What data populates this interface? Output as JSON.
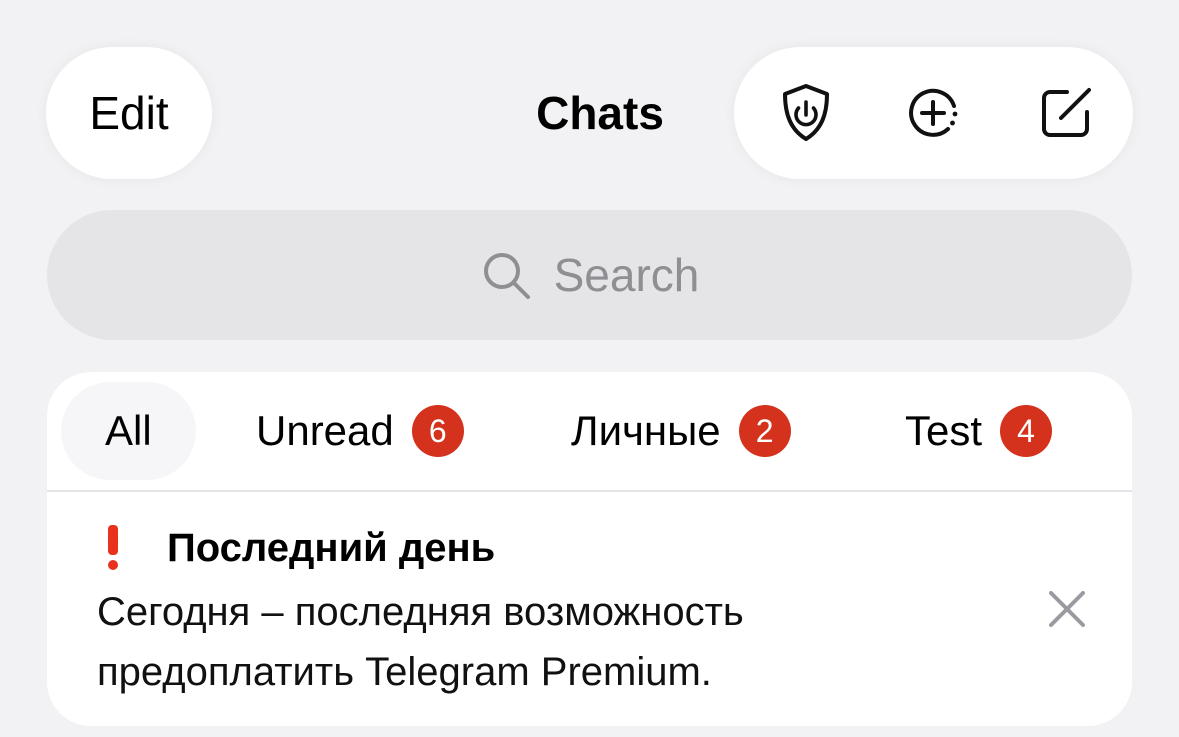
{
  "header": {
    "edit_label": "Edit",
    "title": "Chats",
    "actions": [
      {
        "icon": "shield-power-icon"
      },
      {
        "icon": "add-circle-icon"
      },
      {
        "icon": "compose-icon"
      }
    ]
  },
  "search": {
    "placeholder": "Search",
    "icon": "search-icon"
  },
  "filters": [
    {
      "label": "All",
      "selected": true
    },
    {
      "label": "Unread",
      "badge": "6"
    },
    {
      "label": "Личные",
      "badge": "2"
    },
    {
      "label": "Test",
      "badge": "4"
    }
  ],
  "banner": {
    "icon": "exclamation-icon",
    "title": "Последний день",
    "text": "Сегодня – последняя возможность предоплатить Telegram Premium.",
    "close_icon": "close-icon"
  },
  "colors": {
    "background": "#f2f2f4",
    "badge": "#d4321c",
    "alert": "#e8321e",
    "placeholder": "#8e8e93"
  }
}
